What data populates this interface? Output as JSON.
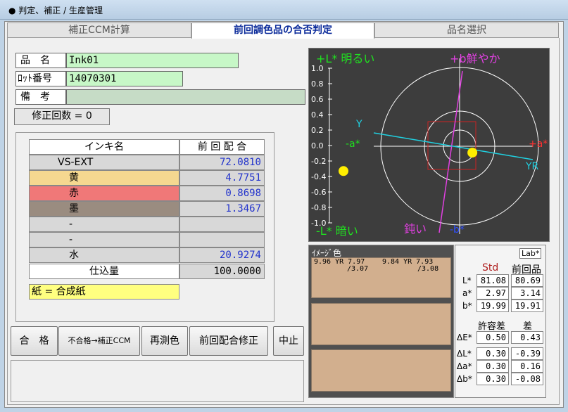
{
  "window": {
    "title": "● 判定、補正 / 生産管理"
  },
  "tabs": [
    {
      "label": "補正CCM計算"
    },
    {
      "label": "前回調色品の合否判定"
    },
    {
      "label": "品名選択"
    }
  ],
  "info": {
    "product_label": "品　名",
    "product_value": "Ink01",
    "lot_label": "ﾛｯﾄ番号",
    "lot_value": "14070301",
    "note_label": "備　考",
    "note_value": "",
    "correction_count": "修正回数 = 0"
  },
  "ink_table": {
    "header_name": "インキ名",
    "header_value": "前 回 配 合",
    "rows": [
      {
        "name": "VS-EXT",
        "value": "72.0810",
        "color": "#d8d8d8"
      },
      {
        "name": "黄",
        "value": "4.7751",
        "color": "#f5d890"
      },
      {
        "name": "赤",
        "value": "0.8698",
        "color": "#f07878"
      },
      {
        "name": "墨",
        "value": "1.3467",
        "color": "#9a8c80"
      },
      {
        "name": "-",
        "value": "",
        "color": "#d8d8d8"
      },
      {
        "name": "-",
        "value": "",
        "color": "#d8d8d8"
      },
      {
        "name": "水",
        "value": "20.9274",
        "color": "#d8d8d8"
      }
    ],
    "total_label": "仕込量",
    "total_value": "100.0000",
    "paper": "紙 = 合成紙"
  },
  "buttons": {
    "pass": "合　格",
    "fail_ccm": "不合格→補正CCM",
    "remeasure": "再測色",
    "prev_fix": "前回配合修正",
    "abort": "中止"
  },
  "plot": {
    "l_top": "+L* 明るい",
    "l_bottom": "-L* 暗い",
    "b_top": "+b鮮やか",
    "b_bottom": "鈍い",
    "b_minus": "-b*",
    "a_plus": "+a*",
    "a_minus": "-a*",
    "y_label": "Y",
    "yr_label": "YR",
    "ticks": [
      "1.0",
      "0.8",
      "0.6",
      "0.4",
      "0.2",
      "0.0",
      "-0.2",
      "-0.4",
      "-0.6",
      "-0.8",
      "-1.0"
    ],
    "l_marker_value": -0.33,
    "ab_marker": {
      "da": 0.16,
      "db": -0.08
    }
  },
  "image_color": {
    "label": "ｲﾒｰｼﾞ色",
    "std_line1": "9.96 YR 7.97",
    "std_line2": "/3.07",
    "prev_line1": "9.84 YR 7.93",
    "prev_line2": "/3.08"
  },
  "lab": {
    "title": "Lab*",
    "std_header": "Std",
    "prev_header": "前回品",
    "L": {
      "label": "L*",
      "std": "81.08",
      "prev": "80.69"
    },
    "a": {
      "label": "a*",
      "std": "2.97",
      "prev": "3.14"
    },
    "b": {
      "label": "b*",
      "std": "19.99",
      "prev": "19.91"
    },
    "tol_header": "許容差",
    "diff_header": "差",
    "dE": {
      "label": "ΔE*",
      "tol": "0.50",
      "diff": "0.43"
    },
    "dL": {
      "label": "ΔL*",
      "tol": "0.30",
      "diff": "-0.39"
    },
    "da": {
      "label": "Δa*",
      "tol": "0.30",
      "diff": "0.16"
    },
    "db": {
      "label": "Δb*",
      "tol": "0.30",
      "diff": "-0.08"
    }
  },
  "colors": {
    "swatch": "#d2af8e",
    "plot_bg": "#3d3d3d",
    "marker": "#ffee00",
    "std_text": "#b02020"
  }
}
